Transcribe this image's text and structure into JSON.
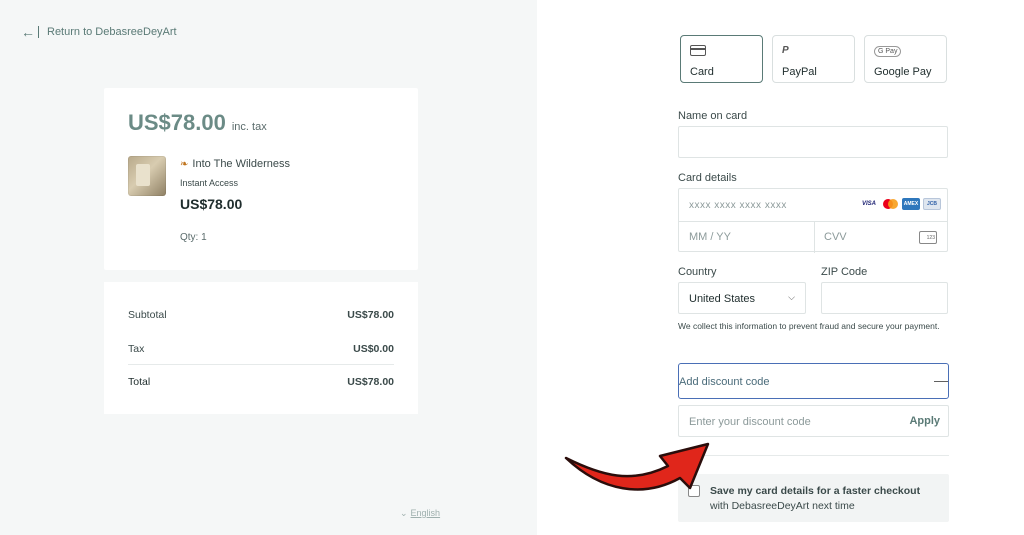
{
  "left": {
    "return_link": "Return to DebasreeDeyArt",
    "summary": {
      "total": "US$78.00",
      "tax_note": "inc. tax",
      "product_name": "Into The Wilderness",
      "product_access": "Instant Access",
      "product_price": "US$78.00",
      "qty": "Qty: 1"
    },
    "breakdown": {
      "subtotal_label": "Subtotal",
      "subtotal_value": "US$78.00",
      "tax_label": "Tax",
      "tax_value": "US$0.00",
      "total_label": "Total",
      "total_value": "US$78.00"
    },
    "language": "English"
  },
  "right": {
    "methods": [
      {
        "label": "Card",
        "selected": true
      },
      {
        "label": "PayPal",
        "selected": false
      },
      {
        "label": "Google Pay",
        "selected": false
      }
    ],
    "name_label": "Name on card",
    "card_label": "Card details",
    "card_placeholder": "xxxx xxxx xxxx xxxx",
    "expiry_placeholder": "MM / YY",
    "cvv_placeholder": "CVV",
    "brands": [
      "VISA",
      "AMEX",
      "JCB"
    ],
    "country_label": "Country",
    "country_value": "United States",
    "zip_label": "ZIP Code",
    "note": "We collect this information to prevent fraud and secure your payment.",
    "discount_label": "Add discount code",
    "discount_placeholder": "Enter your discount code",
    "apply_label": "Apply",
    "save_bold": "Save my card details for a faster checkout",
    "save_rest": "with DebasreeDeyArt next time"
  },
  "colors": {
    "accent": "#5a7a76",
    "focus_border": "#4a6fb6",
    "annotation_arrow": "#e0261b"
  }
}
